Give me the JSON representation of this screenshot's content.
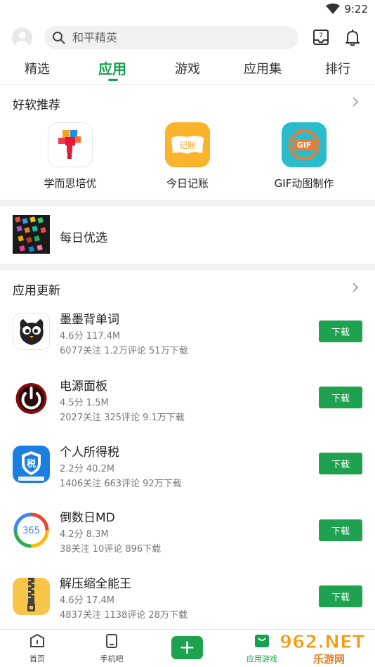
{
  "status": {
    "time": "9:22"
  },
  "search": {
    "placeholder": "和平精英"
  },
  "tabs": [
    {
      "label": "精选"
    },
    {
      "label": "应用"
    },
    {
      "label": "游戏"
    },
    {
      "label": "应用集"
    },
    {
      "label": "排行"
    }
  ],
  "active_tab": "应用",
  "recommend": {
    "title": "好软推荐",
    "items": [
      {
        "label": "学而思培优",
        "icon": "xueersi-app-icon"
      },
      {
        "label": "今日记账",
        "icon": "jizhang-app-icon",
        "icon_text": "记账"
      },
      {
        "label": "GIF动图制作",
        "icon": "gif-app-icon",
        "icon_text": "GIF"
      }
    ]
  },
  "daily": {
    "label": "每日优选"
  },
  "updates": {
    "title": "应用更新",
    "apps": [
      {
        "name": "墨墨背单词",
        "meta1": "4.6分 117.4M",
        "meta2": "6077关注 1.2万评论 51万下载",
        "button": "下载",
        "icon": "owl-app-icon"
      },
      {
        "name": "电源面板",
        "meta1": "4.5分 1.5M",
        "meta2": "2027关注 325评论 9.1万下载",
        "button": "下载",
        "icon": "power-app-icon"
      },
      {
        "name": "个人所得税",
        "meta1": "2.2分 40.2M",
        "meta2": "1406关注 663评论 92万下载",
        "button": "下载",
        "icon": "tax-app-icon",
        "icon_text": "税"
      },
      {
        "name": "倒数日MD",
        "meta1": "4.2分 8.3M",
        "meta2": "38关注 10评论 896下载",
        "button": "下载",
        "icon": "countdown-app-icon",
        "icon_text": "365"
      },
      {
        "name": "解压缩全能王",
        "meta1": "4.6分 17.4M",
        "meta2": "4837关注 1138评论 28万下载",
        "button": "下载",
        "icon": "zip-app-icon"
      }
    ]
  },
  "bottom_nav": {
    "items": [
      {
        "label": "首页"
      },
      {
        "label": "手机吧"
      },
      {
        "label": ""
      },
      {
        "label": "应用游戏"
      }
    ]
  },
  "watermark": {
    "text": "962.NET",
    "subtext": "乐游网"
  },
  "colors": {
    "accent": "#12a14c",
    "button": "#1ea24f"
  }
}
